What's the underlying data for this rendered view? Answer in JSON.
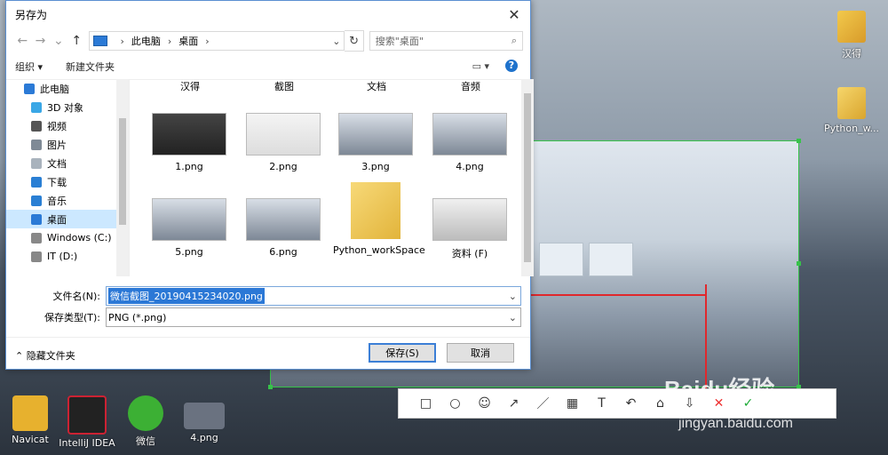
{
  "dialog": {
    "title": "另存为",
    "breadcrumb": [
      "此电脑",
      "桌面"
    ],
    "search_placeholder": "搜索\"桌面\"",
    "toolbar": {
      "organize": "组织 ▾",
      "new_folder": "新建文件夹"
    },
    "nav_items": [
      {
        "label": "此电脑",
        "icon": "computer-icon"
      },
      {
        "label": "3D 对象",
        "icon": "cube-icon"
      },
      {
        "label": "视频",
        "icon": "video-icon"
      },
      {
        "label": "图片",
        "icon": "picture-icon"
      },
      {
        "label": "文档",
        "icon": "document-icon"
      },
      {
        "label": "下载",
        "icon": "download-icon"
      },
      {
        "label": "音乐",
        "icon": "music-icon"
      },
      {
        "label": "桌面",
        "icon": "desktop-icon",
        "selected": true
      },
      {
        "label": "Windows  (C:)",
        "icon": "drive-icon"
      },
      {
        "label": "IT (D:)",
        "icon": "drive-icon"
      }
    ],
    "folder_headers": [
      "汉得",
      "截图",
      "文档",
      "音频"
    ],
    "files_row1": [
      "1.png",
      "2.png",
      "3.png",
      "4.png"
    ],
    "files_row2": [
      "5.png",
      "6.png",
      "Python_workSpace",
      "资料 (F)"
    ],
    "filename_label": "文件名(N):",
    "filename_value": "微信截图_20190415234020.png",
    "filetype_label": "保存类型(T):",
    "filetype_value": "PNG (*.png)",
    "hide_folders": "隐藏文件夹",
    "save_button": "保存(S)",
    "cancel_button": "取消"
  },
  "desktop": {
    "right_icons": [
      "汉得",
      "Python_w..."
    ],
    "bottom_icons": [
      "Navicat",
      "IntelliJ IDEA",
      "微信",
      "4.png"
    ],
    "watermark": "Baidu经验",
    "watermark_url": "jingyan.baidu.com"
  },
  "colors": {
    "selection_border": "#37c24a",
    "annotation": "#e0282c",
    "accent": "#2b78d6"
  }
}
